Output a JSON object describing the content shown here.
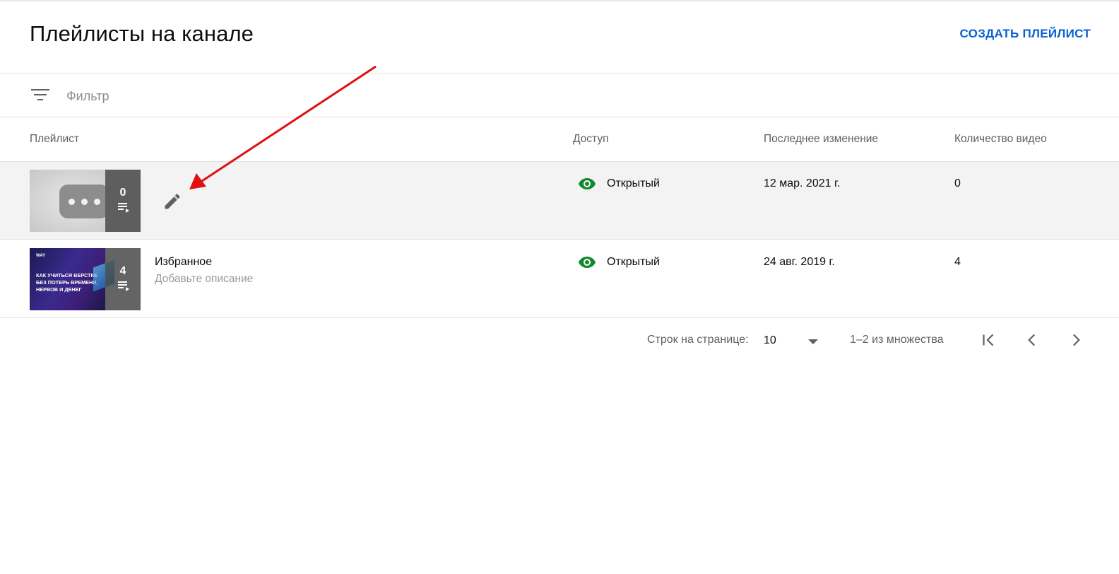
{
  "header": {
    "title": "Плейлисты на канале",
    "create_label": "СОЗДАТЬ ПЛЕЙЛИСТ"
  },
  "filter": {
    "placeholder": "Фильтр"
  },
  "table": {
    "columns": {
      "playlist": "Плейлист",
      "access": "Доступ",
      "modified": "Последнее изменение",
      "count": "Количество видео"
    },
    "rows": [
      {
        "title": "",
        "description": "",
        "thumb_count": "0",
        "access": "Открытый",
        "modified": "12 мар. 2021 г.",
        "video_count": "0"
      },
      {
        "title": "Избранное",
        "description": "Добавьте описание",
        "thumb_count": "4",
        "thumb_logo": "WAY",
        "thumb_text": "КАК УЧИТЬСЯ ВЕРСТКЕ БЕЗ ПОТЕРЬ ВРЕМЕНИ, НЕРВОВ И ДЕНЕГ",
        "access": "Открытый",
        "modified": "24 авг. 2019 г.",
        "video_count": "4"
      }
    ]
  },
  "pagination": {
    "rows_per_page_label": "Строк на странице:",
    "rows_per_page": "10",
    "range": "1–2 из множества"
  },
  "icons": {
    "filter": "filter-icon",
    "edit": "pencil-icon",
    "access": "eye-icon",
    "playlist": "playlist-icon",
    "first_page": "first-page-icon",
    "prev_page": "chevron-left-icon",
    "next_page": "chevron-right-icon"
  },
  "colors": {
    "accent": "#065fd4",
    "access_green": "#0f8a2c",
    "annotation_red": "#e01010"
  }
}
